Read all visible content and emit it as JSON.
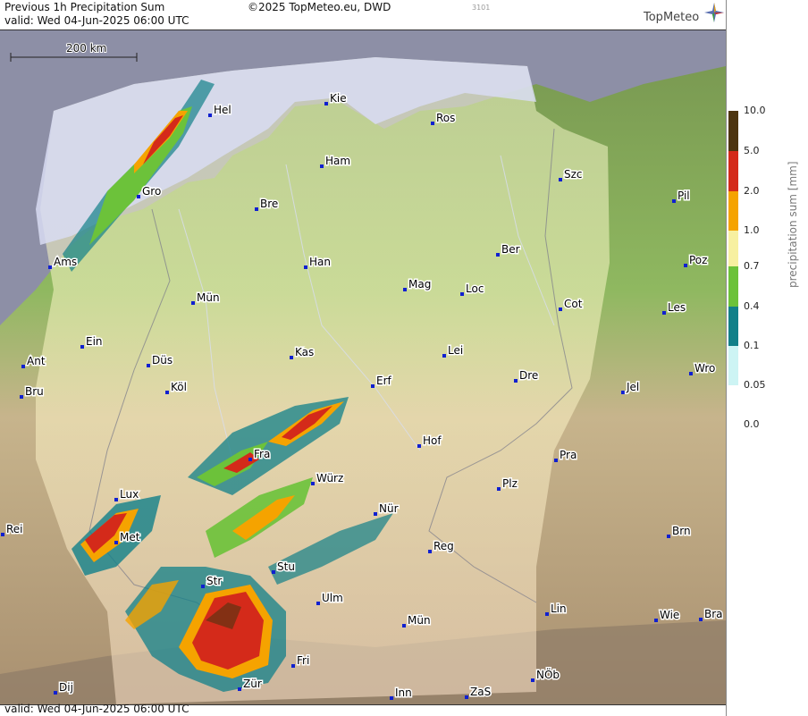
{
  "header": {
    "title": "Previous 1h Precipitation Sum",
    "valid": "valid:  Wed  04-Jun-2025 06:00 UTC",
    "copyright": "©2025 TopMeteo.eu, DWD",
    "code": "3101",
    "logo": "TopMeteo"
  },
  "footer": {
    "valid": "valid:  Wed  04-Jun-2025 06:00 UTC"
  },
  "scale_bar": {
    "label": "200 km"
  },
  "legend": {
    "title": "precipitation sum [mm]",
    "items": [
      {
        "label": "10.0",
        "color": "#4d3510"
      },
      {
        "label": "5.0",
        "color": "#d42a1a"
      },
      {
        "label": "2.0",
        "color": "#f5a300"
      },
      {
        "label": "1.0",
        "color": "#f7f0a0"
      },
      {
        "label": "0.7",
        "color": "#6cc23a"
      },
      {
        "label": "0.4",
        "color": "#128089"
      },
      {
        "label": "0.1",
        "color": "#cdf4f4"
      },
      {
        "label": "0.05",
        "color": ""
      },
      {
        "label": "0.0",
        "color": ""
      }
    ]
  },
  "cities": [
    {
      "name": "Hel"
    },
    {
      "name": "Kie"
    },
    {
      "name": "Ros"
    },
    {
      "name": "Ham"
    },
    {
      "name": "Gro"
    },
    {
      "name": "Bre"
    },
    {
      "name": "Szc"
    },
    {
      "name": "Pil"
    },
    {
      "name": "Ams"
    },
    {
      "name": "Han"
    },
    {
      "name": "Ber"
    },
    {
      "name": "Poz"
    },
    {
      "name": "Mün"
    },
    {
      "name": "Mag"
    },
    {
      "name": "Loc"
    },
    {
      "name": "Cot"
    },
    {
      "name": "Les"
    },
    {
      "name": "Ein"
    },
    {
      "name": "Kas"
    },
    {
      "name": "Lei"
    },
    {
      "name": "Ant"
    },
    {
      "name": "Düs"
    },
    {
      "name": "Wro"
    },
    {
      "name": "Dre"
    },
    {
      "name": "Bru"
    },
    {
      "name": "Köl"
    },
    {
      "name": "Erf"
    },
    {
      "name": "Jel"
    },
    {
      "name": "Hof"
    },
    {
      "name": "Fra"
    },
    {
      "name": "Pra"
    },
    {
      "name": "Würz"
    },
    {
      "name": "Lux"
    },
    {
      "name": "Plz"
    },
    {
      "name": "Nür"
    },
    {
      "name": "Rei"
    },
    {
      "name": "Met"
    },
    {
      "name": "Brn"
    },
    {
      "name": "Reg"
    },
    {
      "name": "Stu"
    },
    {
      "name": "Str"
    },
    {
      "name": "Ulm"
    },
    {
      "name": "Lin"
    },
    {
      "name": "Mün"
    },
    {
      "name": "Wie"
    },
    {
      "name": "Bra"
    },
    {
      "name": "Fri"
    },
    {
      "name": "NÖb"
    },
    {
      "name": "Dij"
    },
    {
      "name": "Zür"
    },
    {
      "name": "Inn"
    },
    {
      "name": "ZaS"
    }
  ]
}
